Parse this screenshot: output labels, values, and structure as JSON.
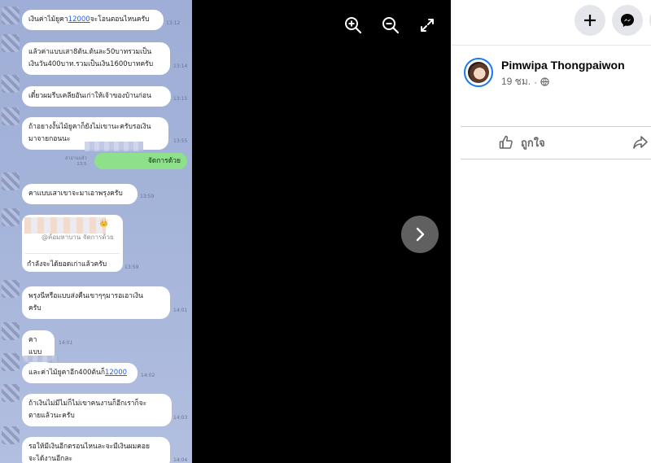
{
  "chat": {
    "messages": [
      {
        "text_before": "เงินค่าไม้ยูคา",
        "link": "12000",
        "text_after": "จะโอนตอนไหนครับ",
        "time": "13:12"
      },
      {
        "line1": "แล้วค่าแบบเสา8ต้น.ต้นละ50บาทรวมเป็น",
        "line2": "เงินวัน400บาท.รวมเป็นเงิน1600บาทครับ",
        "time": "13:14"
      },
      {
        "text": "เดี๋ยวผมรีบเคลียอันเก่าให้เจ้าของบ้านก่อน",
        "time": "13:15"
      },
      {
        "line1": "ถ้าอยางงั้นไม้ยูคาก็ยังไม่เขานะครับรอเงิน",
        "line2": "มาจายกอนนะ",
        "time": "13:55"
      },
      {
        "text": "คาแบบเสาเขาจะมาเอาพรุงครับ",
        "time": "13:59"
      },
      {
        "text": "พรุงนีหรือแบบส่งคืนเขาๆๆมารอเอาเงิน",
        "line2": "ครับ",
        "time": "14:01"
      },
      {
        "text": "คาแบบ",
        "time": "14:01"
      },
      {
        "text_before": "และค่าไม้ยูคาอีก400ต้นก็",
        "link": "12000",
        "time": "14:02"
      },
      {
        "line1": "ถ้าเงินไม่มีไม่ก็ไม่เขาคนงานก็อีกเราก็จะ",
        "line2": "ตายแล้วนะครับ",
        "time": "14:03"
      },
      {
        "line1": "รอให้มีเงินอีกตรอนไหนละจะมีเงินผมคอย",
        "line2": "จะได้งานอีกละ",
        "time": "14:04"
      }
    ],
    "my_message": {
      "text": "จัดการด้วย",
      "read": "สาอ่านแล้ว",
      "time": "13:5"
    },
    "quote": {
      "emoji": "👑",
      "quoted": "@ค้อมหาบาน จัดการด้วย",
      "reply": "กำลังจะได้ยอดเก่าแล้วครับ",
      "time": "13:59"
    }
  },
  "viewer": {
    "zoom_in": "zoom-in-icon",
    "zoom_out": "zoom-out-icon",
    "fullscreen": "fullscreen-icon",
    "next": "chevron-right-icon"
  },
  "post": {
    "author": "Pimwipa Thongpaiwon",
    "time": "19 ชม.",
    "separator": "·",
    "like_label": "ถูกใจ"
  },
  "colors": {
    "accent": "#1877f2",
    "panel_bg": "#ffffff",
    "stage_bg": "#000000",
    "my_bubble": "#8ee08a"
  }
}
